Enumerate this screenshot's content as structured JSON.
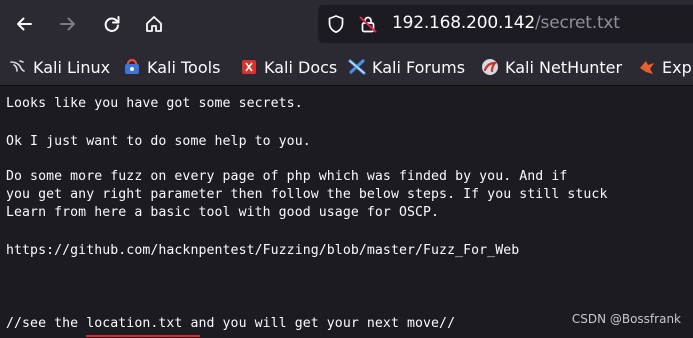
{
  "url": {
    "host": "192.168.200.142",
    "path": "/secret.txt"
  },
  "bookmarks": [
    {
      "label": "Kali Linux",
      "icon": "kali-dragon-icon"
    },
    {
      "label": "Kali Tools",
      "icon": "kali-tools-icon"
    },
    {
      "label": "Kali Docs",
      "icon": "kali-docs-icon"
    },
    {
      "label": "Kali Forums",
      "icon": "kali-forums-icon"
    },
    {
      "label": "Kali NetHunter",
      "icon": "kali-nethunter-icon"
    },
    {
      "label": "Expl",
      "icon": "exploit-db-icon"
    }
  ],
  "content": {
    "lines": [
      "Looks like you have got some secrets.",
      "Ok I just want to do some help to you.",
      "Do some more fuzz on every page of php which was finded by you. And if",
      "you get any right parameter then follow the below steps. If you still stuck",
      "Learn from here a basic tool with good usage for OSCP.",
      "https://github.com/hacknpentest/Fuzzing/blob/master/Fuzz_For_Web",
      "//see the location.txt and you will get your next move//"
    ]
  },
  "watermark": "CSDN @Bossfrank",
  "colors": {
    "toolbar": "#2b2a33",
    "page_bg": "#1c1b22",
    "text": "#fbfbfe",
    "annotation_underline": "#e0262b"
  }
}
